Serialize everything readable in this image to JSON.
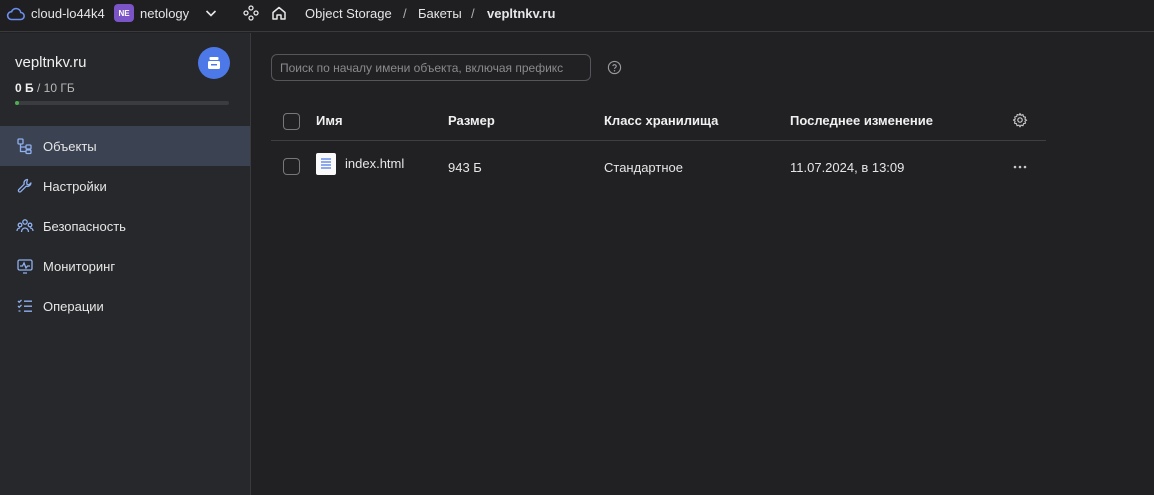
{
  "topbar": {
    "cloud_name": "cloud-lo44k4",
    "folder_badge": "NE",
    "folder_name": "netology",
    "breadcrumbs": [
      "Object Storage",
      "Бакеты",
      "vepltnkv.ru"
    ],
    "separator": "/"
  },
  "sidebar": {
    "bucket_name": "vepltnkv.ru",
    "usage_used": "0 Б",
    "usage_total": "/ 10 ГБ",
    "usage_fraction": 0.002,
    "items": [
      {
        "label": "Объекты",
        "icon": "objects-icon",
        "active": true
      },
      {
        "label": "Настройки",
        "icon": "settings-wrench-icon",
        "active": false
      },
      {
        "label": "Безопасность",
        "icon": "security-users-icon",
        "active": false
      },
      {
        "label": "Мониторинг",
        "icon": "monitoring-icon",
        "active": false
      },
      {
        "label": "Операции",
        "icon": "operations-list-icon",
        "active": false
      }
    ]
  },
  "main": {
    "search_placeholder": "Поиск по началу имени объекта, включая префикс",
    "columns": {
      "name": "Имя",
      "size": "Размер",
      "storage_class": "Класс хранилища",
      "modified": "Последнее изменение"
    },
    "rows": [
      {
        "name": "index.html",
        "size": "943 Б",
        "storage_class": "Стандартное",
        "modified": "11.07.2024, в 13:09"
      }
    ]
  },
  "colors": {
    "accent_avatar": "#4d79e8",
    "folder_badge": "#7b54c7",
    "active_nav": "#3b4252",
    "usage_bar": "#4caf50"
  }
}
